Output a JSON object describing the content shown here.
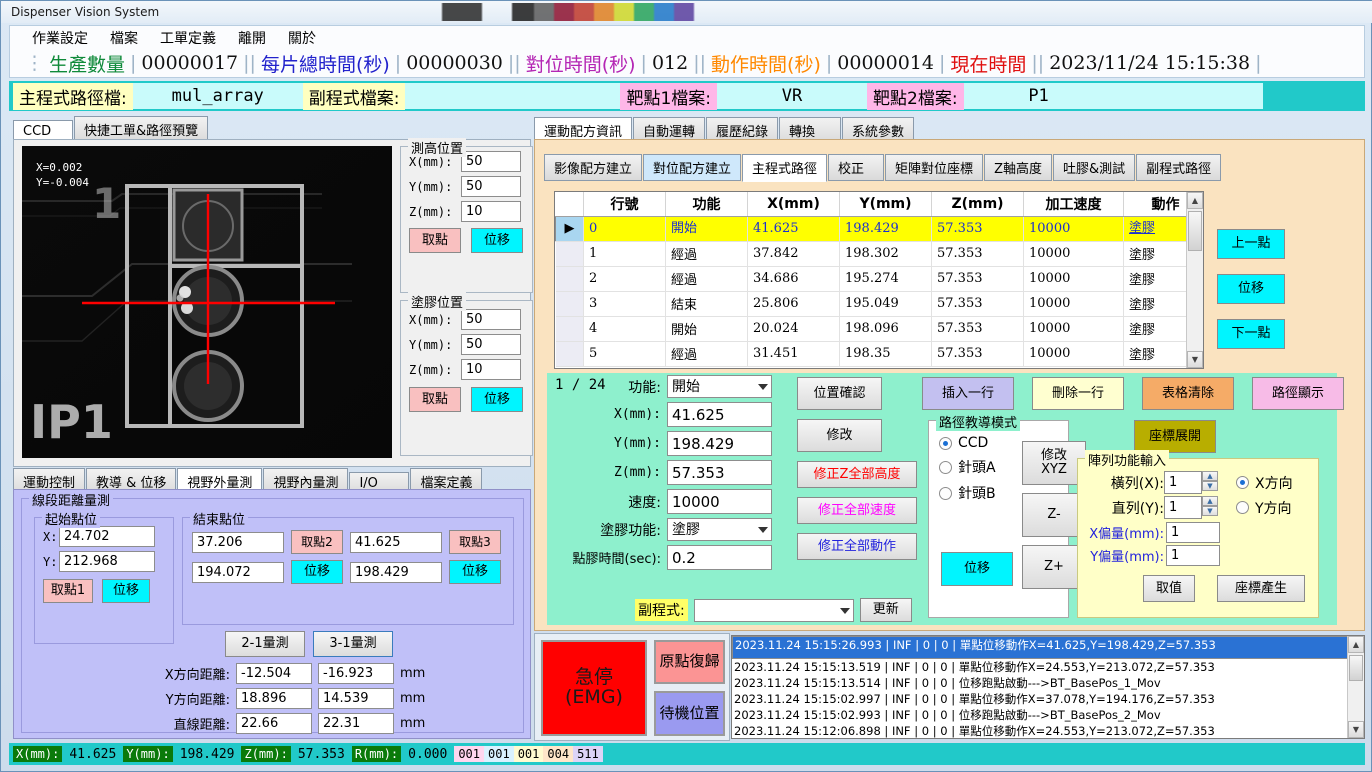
{
  "window": {
    "title": "Dispenser Vision System"
  },
  "menu": {
    "items": [
      "作業設定",
      "檔案",
      "工單定義",
      "離開",
      "關於"
    ]
  },
  "counters": [
    {
      "label": "生產數量",
      "value": "00000017",
      "color": "green"
    },
    {
      "label": "每片總時間(秒)",
      "value": "00000030",
      "color": "blue"
    },
    {
      "label": "對位時間(秒)",
      "value": "012",
      "color": "purple"
    },
    {
      "label": "動作時間(秒)",
      "value": "00000014",
      "color": "orange"
    },
    {
      "label": "現在時間",
      "value": "2023/11/24  15:15:38",
      "color": "red"
    }
  ],
  "pathbar": {
    "main_label": "主程式路徑檔:",
    "main_value": "mul_array",
    "sub_label": "副程式檔案:",
    "sub_value": "",
    "target1_label": "靶點1檔案:",
    "target1_value": "VR",
    "target2_label": "靶點2檔案:",
    "target2_value": "P1"
  },
  "left": {
    "tabs": [
      {
        "label": "CCD",
        "active": true
      },
      {
        "label": "快捷工單&路徑預覽",
        "active": false
      }
    ],
    "camera": {
      "x_readout": "X=0.002",
      "y_readout": "Y=-0.004",
      "silk_label": "IP1",
      "silk_num": "1"
    },
    "height_group": {
      "title": "測高位置",
      "fields": [
        {
          "label": "X(mm):",
          "value": "50"
        },
        {
          "label": "Y(mm):",
          "value": "50"
        },
        {
          "label": "Z(mm):",
          "value": "10"
        }
      ],
      "pick_button": "取點",
      "move_button": "位移"
    },
    "glue_group": {
      "title": "塗膠位置",
      "fields": [
        {
          "label": "X(mm):",
          "value": "50"
        },
        {
          "label": "Y(mm):",
          "value": "50"
        },
        {
          "label": "Z(mm):",
          "value": "10"
        }
      ],
      "pick_button": "取點",
      "move_button": "位移"
    }
  },
  "measure": {
    "tabs": [
      {
        "label": "運動控制",
        "active": false
      },
      {
        "label": "教導 & 位移",
        "active": false
      },
      {
        "label": "視野外量測",
        "active": true
      },
      {
        "label": "視野內量測",
        "active": false
      },
      {
        "label": "I/O",
        "active": false
      },
      {
        "label": "檔案定義",
        "active": false
      }
    ],
    "group_title": "線段距離量測",
    "start_group": {
      "title": "起始點位",
      "x_label": "X:",
      "x_value": "24.702",
      "y_label": "Y:",
      "y_value": "212.968",
      "pick_button": "取點1",
      "move_button": "位移"
    },
    "end_group": {
      "title": "結束點位",
      "p2_x": "37.206",
      "p2_y": "194.072",
      "p2_pick": "取點2",
      "p2_move": "位移",
      "p3_x": "41.625",
      "p3_y": "198.429",
      "p3_pick": "取點3",
      "p3_move": "位移"
    },
    "measure_buttons": [
      "2-1量測",
      "3-1量測"
    ],
    "rows": [
      {
        "label": "X方向距離:",
        "v1": "-12.504",
        "v2": "-16.923",
        "unit": "mm"
      },
      {
        "label": "Y方向距離:",
        "v1": "18.896",
        "v2": "14.539",
        "unit": "mm"
      },
      {
        "label": "直線距離:",
        "v1": "22.66",
        "v2": "22.31",
        "unit": "mm"
      }
    ]
  },
  "right": {
    "tabs": [
      {
        "label": "運動配方資訊",
        "active": true
      },
      {
        "label": "自動運轉",
        "active": false
      },
      {
        "label": "履歷紀錄",
        "active": false
      },
      {
        "label": "轉換",
        "active": false
      },
      {
        "label": "系統參數",
        "active": false
      }
    ],
    "subtabs": [
      {
        "label": "影像配方建立",
        "active": false,
        "hl": false
      },
      {
        "label": "對位配方建立",
        "active": false,
        "hl": true
      },
      {
        "label": "主程式路徑",
        "active": true,
        "hl": false
      },
      {
        "label": "校正",
        "active": false,
        "hl": false
      },
      {
        "label": "矩陣對位座標",
        "active": false,
        "hl": false
      },
      {
        "label": "Z軸高度",
        "active": false,
        "hl": false
      },
      {
        "label": "吐膠&測試",
        "active": false,
        "hl": false
      },
      {
        "label": "副程式路徑",
        "active": false,
        "hl": false
      }
    ],
    "grid": {
      "headers": [
        "行號",
        "功能",
        "X(mm)",
        "Y(mm)",
        "Z(mm)",
        "加工速度",
        "動作"
      ],
      "rows": [
        {
          "selected": true,
          "cells": [
            "0",
            "開始",
            "41.625",
            "198.429",
            "57.353",
            "10000",
            "塗膠"
          ]
        },
        {
          "selected": false,
          "cells": [
            "1",
            "經過",
            "37.842",
            "198.302",
            "57.353",
            "10000",
            "塗膠"
          ]
        },
        {
          "selected": false,
          "cells": [
            "2",
            "經過",
            "34.686",
            "195.274",
            "57.353",
            "10000",
            "塗膠"
          ]
        },
        {
          "selected": false,
          "cells": [
            "3",
            "結束",
            "25.806",
            "195.049",
            "57.353",
            "10000",
            "塗膠"
          ]
        },
        {
          "selected": false,
          "cells": [
            "4",
            "開始",
            "20.024",
            "198.096",
            "57.353",
            "10000",
            "塗膠"
          ]
        },
        {
          "selected": false,
          "cells": [
            "5",
            "經過",
            "31.451",
            "198.35",
            "57.353",
            "10000",
            "塗膠"
          ]
        }
      ]
    },
    "nav_buttons": [
      "上一點",
      "位移",
      "下一點"
    ],
    "editor": {
      "counter": "1 / 24",
      "fields": [
        {
          "label": "功能:",
          "value": "開始",
          "type": "select"
        },
        {
          "label": "X(mm):",
          "value": "41.625",
          "type": "text"
        },
        {
          "label": "Y(mm):",
          "value": "198.429",
          "type": "text"
        },
        {
          "label": "Z(mm):",
          "value": "57.353",
          "type": "text"
        },
        {
          "label": "速度:",
          "value": "10000",
          "type": "text"
        },
        {
          "label": "塗膠功能:",
          "value": "塗膠",
          "type": "select"
        },
        {
          "label": "點膠時間(sec):",
          "value": "0.2",
          "type": "text"
        }
      ],
      "sub_label": "副程式:",
      "sub_value": "",
      "update_button": "更新",
      "confirm_button": "位置確認",
      "modify_button": "修改",
      "fixz_button": "修正Z全部高度",
      "fixspeed_button": "修正全部速度",
      "fixaction_button": "修正全部動作",
      "insert_button": "插入一行",
      "delete_button": "刪除一行",
      "clear_button": "表格清除",
      "show_path_button": "路徑顯示",
      "expand_button": "座標展開"
    },
    "teach_mode": {
      "title": "路徑教導模式",
      "options": [
        {
          "label": "CCD",
          "selected": true
        },
        {
          "label": "針頭A",
          "selected": false
        },
        {
          "label": "針頭B",
          "selected": false
        }
      ],
      "move_button": "位移",
      "modify_xyz_button": "修改\nXYZ",
      "z_minus_button": "Z-",
      "z_plus_button": "Z+"
    },
    "array": {
      "title": "陣列功能輸入",
      "rows_label": "橫列(X):",
      "rows_value": "1",
      "cols_label": "直列(Y):",
      "cols_value": "1",
      "xoff_label": "X偏量(mm):",
      "xoff_value": "1",
      "yoff_label": "Y偏量(mm):",
      "yoff_value": "1",
      "dir_options": [
        {
          "label": "X方向",
          "selected": true
        },
        {
          "label": "Y方向",
          "selected": false
        }
      ],
      "get_button": "取值",
      "gen_button": "座標產生"
    }
  },
  "emergency": {
    "stop_line1": "急停",
    "stop_line2": "(EMG)",
    "home_button": "原點復歸",
    "standby_button": "待機位置"
  },
  "log": {
    "lines": [
      {
        "selected": true,
        "text": "2023.11.24 15:15:26.993 | INF | 0 | 0 | 單點位移動作X=41.625,Y=198.429,Z=57.353"
      },
      {
        "selected": false,
        "text": "2023.11.24 15:15:13.519 | INF | 0 | 0 | 單點位移動作X=24.553,Y=213.072,Z=57.353"
      },
      {
        "selected": false,
        "text": "2023.11.24 15:15:13.514 | INF | 0 | 0 | 位移跑點啟動--->BT_BasePos_1_Mov"
      },
      {
        "selected": false,
        "text": "2023.11.24 15:15:02.997 | INF | 0 | 0 | 單點位移動作X=37.078,Y=194.176,Z=57.353"
      },
      {
        "selected": false,
        "text": "2023.11.24 15:15:02.993 | INF | 0 | 0 | 位移跑點啟動--->BT_BasePos_2_Mov"
      },
      {
        "selected": false,
        "text": "2023.11.24 15:12:06.898 | INF | 0 | 0 | 單點位移動作X=24.553,Y=213.072,Z=57.353"
      }
    ]
  },
  "statusbar": {
    "items": [
      {
        "label": "X(mm):",
        "value": "41.625"
      },
      {
        "label": "Y(mm):",
        "value": "198.429"
      },
      {
        "label": "Z(mm):",
        "value": "57.353"
      },
      {
        "label": "R(mm):",
        "value": "0.000"
      }
    ],
    "boxes": [
      {
        "text": "001",
        "color": "#ffd6ef"
      },
      {
        "text": "001",
        "color": "#d9f2ff"
      },
      {
        "text": "001",
        "color": "#fffbd0"
      },
      {
        "text": "004",
        "color": "#ffe6c9"
      },
      {
        "text": "511",
        "color": "#ddd4f7"
      }
    ]
  },
  "colors": {
    "accent_cyan": "#21c9c9",
    "teal_panel": "#8ef0cd",
    "tan_panel": "#fae3c0",
    "lavender_panel": "#c0c0f8",
    "select_yellow": "#ffff00",
    "emg_red": "#ff0000"
  }
}
